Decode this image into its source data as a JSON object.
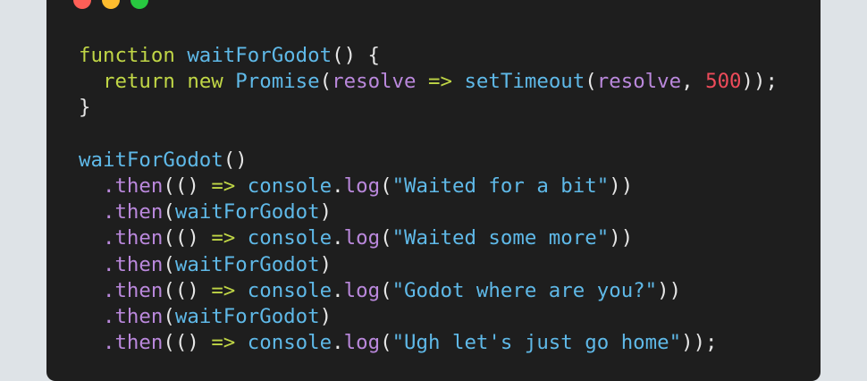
{
  "window": {
    "controls": {
      "close_color": "#ff5f57",
      "minimize_color": "#febc2e",
      "maximize_color": "#28c840"
    }
  },
  "code": {
    "language": "javascript",
    "line1": {
      "kw": "function",
      "name": "waitForGodot",
      "rest": "() {"
    },
    "line2": {
      "kw1": "return",
      "kw2": "new",
      "cls": "Promise",
      "p1": "(",
      "param": "resolve",
      "arrow": "=>",
      "fn": "setTimeout",
      "p2": "(",
      "param2": "resolve",
      "comma": ", ",
      "num": "500",
      "end": "));"
    },
    "line3": {
      "text": "}"
    },
    "line5": {
      "fn": "waitForGodot",
      "rest": "()"
    },
    "chain": [
      {
        "method": ".then",
        "open": "((",
        "close": ") ",
        "arrow": "=>",
        "obj": "console",
        "dot": ".",
        "log": "log",
        "lp": "(",
        "str": "\"Waited for a bit\"",
        "end": "))"
      },
      {
        "method": ".then",
        "open": "(",
        "fn": "waitForGodot",
        "end": ")"
      },
      {
        "method": ".then",
        "open": "((",
        "close": ") ",
        "arrow": "=>",
        "obj": "console",
        "dot": ".",
        "log": "log",
        "lp": "(",
        "str": "\"Waited some more\"",
        "end": "))"
      },
      {
        "method": ".then",
        "open": "(",
        "fn": "waitForGodot",
        "end": ")"
      },
      {
        "method": ".then",
        "open": "((",
        "close": ") ",
        "arrow": "=>",
        "obj": "console",
        "dot": ".",
        "log": "log",
        "lp": "(",
        "str": "\"Godot where are you?\"",
        "end": "))"
      },
      {
        "method": ".then",
        "open": "(",
        "fn": "waitForGodot",
        "end": ")"
      },
      {
        "method": ".then",
        "open": "((",
        "close": ") ",
        "arrow": "=>",
        "obj": "console",
        "dot": ".",
        "log": "log",
        "lp": "(",
        "str": "\"Ugh let's just go home\"",
        "end": "));"
      }
    ]
  },
  "colors": {
    "background": "#dee3e7",
    "editor": "#1e1e1e",
    "keyword": "#c0d646",
    "function": "#5fb9e8",
    "parameter": "#ba88dc",
    "number": "#ee4b5a",
    "string": "#5fb9e8"
  }
}
